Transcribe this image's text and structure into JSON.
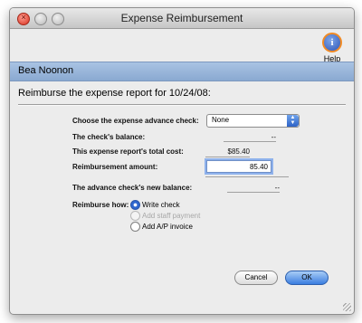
{
  "window": {
    "title": "Expense Reimbursement"
  },
  "toolbar": {
    "help_label": "Help",
    "help_glyph": "i"
  },
  "banner": {
    "name": "Bea Noonon"
  },
  "form": {
    "prompt": "Reimburse the expense report for 10/24/08:",
    "advance_check": {
      "label": "Choose the expense advance check:",
      "selected": "None",
      "options": [
        "None"
      ]
    },
    "checks_balance": {
      "label": "The check's balance:",
      "value": "--"
    },
    "report_total": {
      "label": "This expense report's total cost:",
      "value": "$85.40"
    },
    "reimbursement_amount": {
      "label": "Reimbursement amount:",
      "value": "85.40"
    },
    "new_balance": {
      "label": "The advance check's new balance:",
      "value": "--"
    },
    "reimburse_how": {
      "label": "Reimburse how:",
      "options": [
        {
          "label": "Write check",
          "selected": true,
          "enabled": true
        },
        {
          "label": "Add staff payment",
          "selected": false,
          "enabled": false
        },
        {
          "label": "Add A/P invoice",
          "selected": false,
          "enabled": true
        }
      ]
    }
  },
  "buttons": {
    "cancel": "Cancel",
    "ok": "OK"
  },
  "colors": {
    "banner": "#96b2d8",
    "default_button": "#3a7ee0",
    "close_light": "#d7301f"
  }
}
